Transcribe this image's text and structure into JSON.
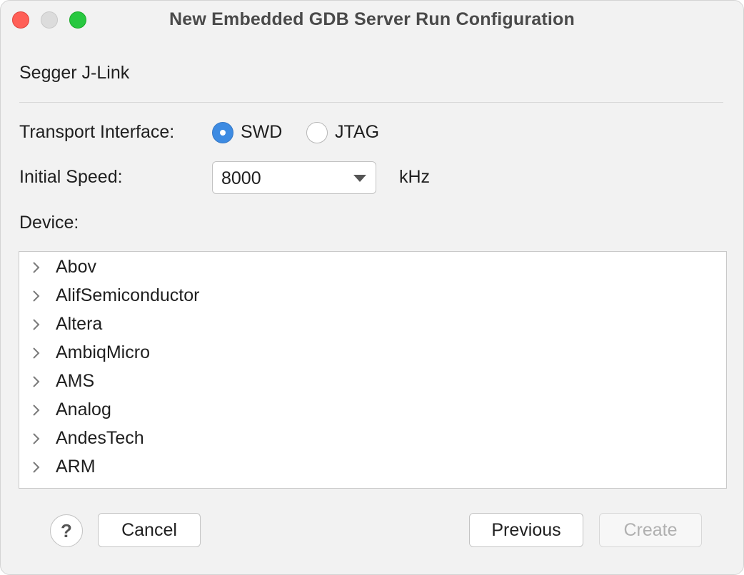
{
  "window": {
    "title": "New Embedded GDB Server Run Configuration"
  },
  "section": {
    "label": "Segger J-Link"
  },
  "transport": {
    "label": "Transport Interface:",
    "options": [
      {
        "label": "SWD",
        "selected": true
      },
      {
        "label": "JTAG",
        "selected": false
      }
    ]
  },
  "speed": {
    "label": "Initial Speed:",
    "value": "8000",
    "unit": "kHz"
  },
  "device": {
    "label": "Device:",
    "items": [
      "Abov",
      "AlifSemiconductor",
      "Altera",
      "AmbiqMicro",
      "AMS",
      "Analog",
      "AndesTech",
      "ARM"
    ]
  },
  "buttons": {
    "help": "?",
    "cancel": "Cancel",
    "previous": "Previous",
    "create": "Create"
  },
  "colors": {
    "accent": "#3d8be2",
    "close": "#ff5f57",
    "maximize": "#28c840"
  }
}
